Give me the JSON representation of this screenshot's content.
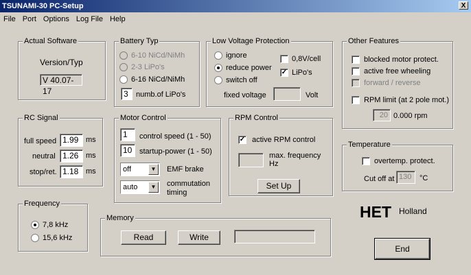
{
  "window": {
    "title": "TSUNAMI-30  PC-Setup",
    "close_label": "X"
  },
  "menu": [
    "File",
    "Port",
    "Options",
    "Log File",
    "Help"
  ],
  "actual_software": {
    "title": "Actual Software",
    "label": "Version/Typ",
    "value": "V 40.07-17"
  },
  "battery": {
    "title": "Battery Typ",
    "options": [
      "6-10 NiCd/NiMh",
      "2-3 LiPo's",
      "6-16 NiCd/NiMh"
    ],
    "lipo_count": "3",
    "lipo_label": "numb.of LiPo's"
  },
  "low_voltage": {
    "title": "Low Voltage Protection",
    "options": [
      "ignore",
      "reduce power",
      "switch off"
    ],
    "cell_08": "0,8V/cell",
    "lipos": "LiPo's",
    "fixed_label": "fixed voltage",
    "fixed_value": "",
    "volt": "Volt"
  },
  "other": {
    "title": "Other Features",
    "blocked": "blocked motor protect.",
    "freewheel": "active free wheeling",
    "forward": "forward / reverse",
    "rpm_limit": "RPM limit (at 2 pole mot.)",
    "rpm_value": "20",
    "rpm_text": "0.000 rpm"
  },
  "rc": {
    "title": "RC Signal",
    "full_label": "full speed",
    "full_value": "1.99",
    "neutral_label": "neutral",
    "neutral_value": "1.26",
    "stop_label": "stop/ret.",
    "stop_value": "1.18",
    "unit": "ms"
  },
  "motor": {
    "title": "Motor Control",
    "speed_value": "1",
    "speed_label": "control speed (1 - 50)",
    "startup_value": "10",
    "startup_label": "startup-power (1 - 50)",
    "emf_value": "off",
    "emf_label": "EMF brake",
    "comm_value": "auto",
    "comm_label1": "commutation",
    "comm_label2": "timing",
    "arrow": "▼"
  },
  "rpm": {
    "title": "RPM Control",
    "active": "active RPM control",
    "max_value": "",
    "max_label1": "max. frequency",
    "max_label2": "Hz",
    "setup": "Set Up"
  },
  "temperature": {
    "title": "Temperature",
    "overtemp": "overtemp. protect.",
    "cutoff_label": "Cut off at",
    "cutoff_value": "130",
    "unit": "°C"
  },
  "frequency": {
    "title": "Frequency",
    "opt1": "7,8 kHz",
    "opt2": "15,6 kHz"
  },
  "memory": {
    "title": "Memory",
    "read": "Read",
    "write": "Write",
    "status": ""
  },
  "brand": {
    "logo": "HET",
    "sub": "Holland"
  },
  "end": "End"
}
